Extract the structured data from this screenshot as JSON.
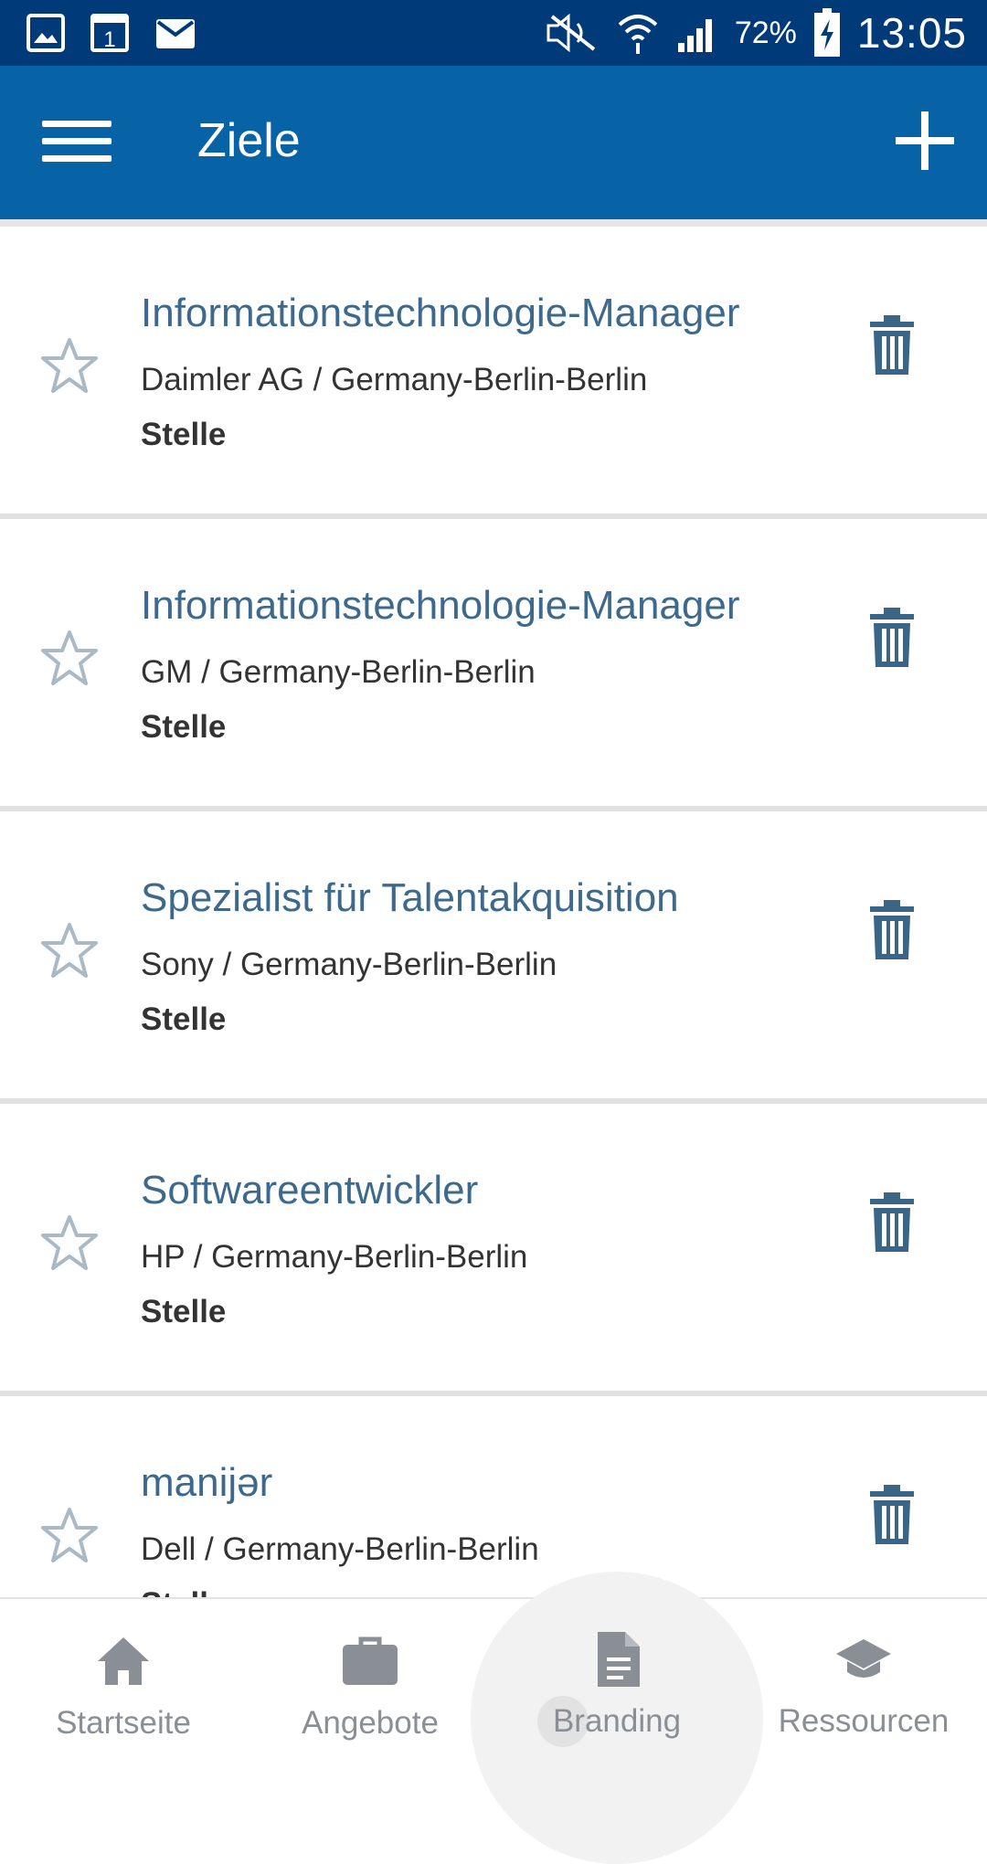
{
  "status_bar": {
    "battery_percent": "72%",
    "time": "13:05"
  },
  "app_bar": {
    "title": "Ziele"
  },
  "items": [
    {
      "title": "Informationstechnologie-Manager",
      "subtitle": "Daimler AG / Germany-Berlin-Berlin",
      "type": "Stelle"
    },
    {
      "title": "Informationstechnologie-Manager",
      "subtitle": "GM / Germany-Berlin-Berlin",
      "type": "Stelle"
    },
    {
      "title": "Spezialist für Talentakquisition",
      "subtitle": "Sony / Germany-Berlin-Berlin",
      "type": "Stelle"
    },
    {
      "title": "Softwareentwickler",
      "subtitle": "HP / Germany-Berlin-Berlin",
      "type": "Stelle"
    },
    {
      "title": "manijər",
      "subtitle": "Dell / Germany-Berlin-Berlin",
      "type": "Stelle"
    }
  ],
  "bottom_nav": [
    {
      "label": "Startseite",
      "icon": "home-icon"
    },
    {
      "label": "Angebote",
      "icon": "briefcase-icon"
    },
    {
      "label": "Branding",
      "icon": "document-icon"
    },
    {
      "label": "Ressourcen",
      "icon": "graduation-cap-icon"
    }
  ],
  "colors": {
    "status_bar": "#003a78",
    "app_bar": "#0762a6",
    "title_text": "#3d6a8c",
    "icon_dark": "#3a6587",
    "nav_gray": "#8a8f96"
  }
}
